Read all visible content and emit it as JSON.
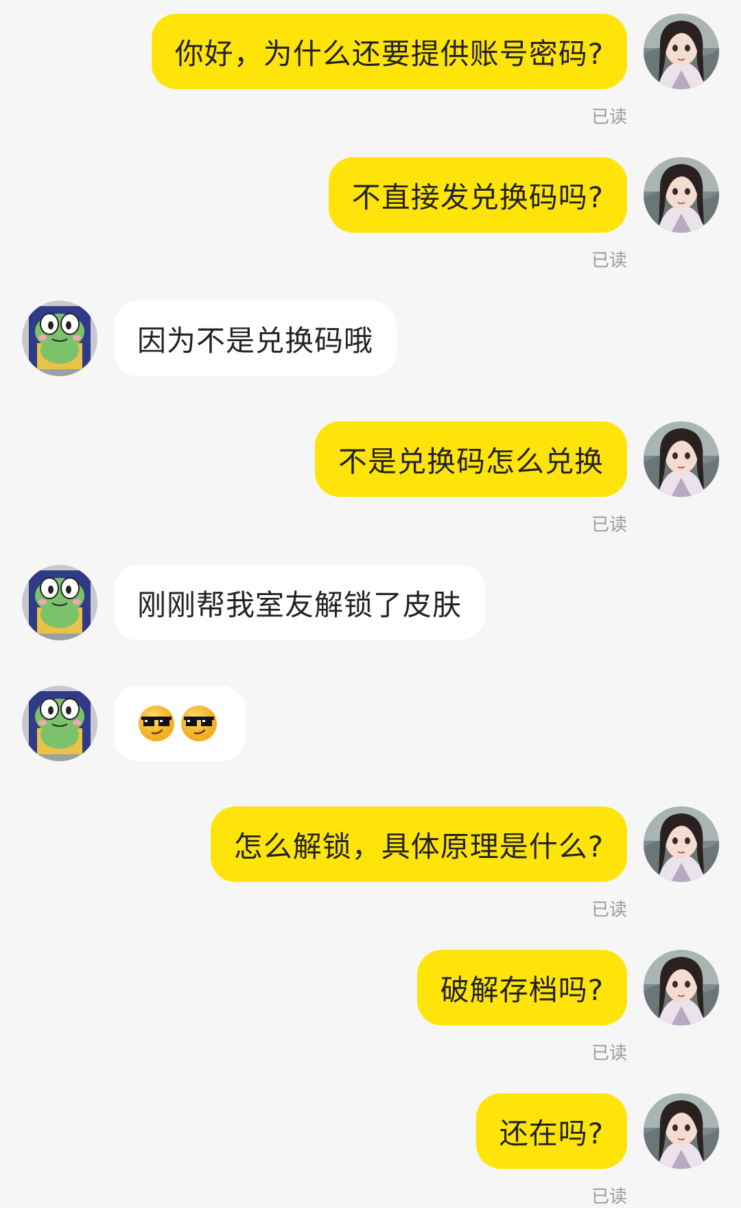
{
  "messages": [
    {
      "sender": "me",
      "text": "你好，为什么还要提供账号密码?",
      "read": "已读"
    },
    {
      "sender": "me",
      "text": "不直接发兑换码吗?",
      "read": "已读"
    },
    {
      "sender": "other",
      "text": "因为不是兑换码哦"
    },
    {
      "sender": "me",
      "text": "不是兑换码怎么兑换",
      "read": "已读"
    },
    {
      "sender": "other",
      "text": "刚刚帮我室友解锁了皮肤"
    },
    {
      "sender": "other",
      "emoji": [
        "cool-sunglasses-emoji",
        "cool-sunglasses-emoji"
      ]
    },
    {
      "sender": "me",
      "text": "怎么解锁，具体原理是什么?",
      "read": "已读"
    },
    {
      "sender": "me",
      "text": "破解存档吗?",
      "read": "已读"
    },
    {
      "sender": "me",
      "text": "还在吗?",
      "read": "已读"
    }
  ],
  "colors": {
    "background": "#f6f6f6",
    "my_bubble": "#ffe40a",
    "other_bubble": "#ffffff",
    "read_label": "#9a9a9a"
  },
  "icons": {
    "my_avatar": "anime-girl-avatar",
    "other_avatar": "green-frog-avatar"
  }
}
